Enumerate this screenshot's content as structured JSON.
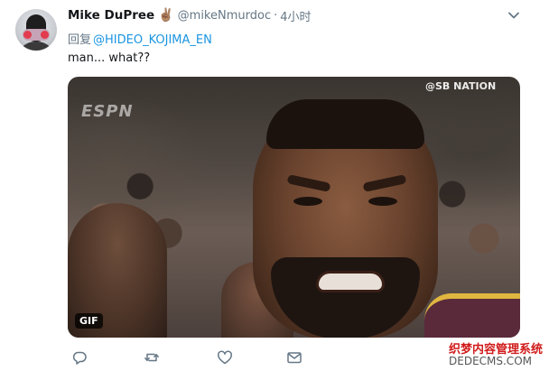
{
  "tweet": {
    "author": {
      "display_name": "Mike DuPree",
      "emoji": "✌🏽",
      "handle": "@mikeNmurdoc",
      "separator": "·",
      "time": "4小时"
    },
    "reply": {
      "prefix": "回复",
      "mention": "@HIDEO_KOJIMA_EN"
    },
    "text": "man... what??",
    "media": {
      "badge": "GIF",
      "watermark_espn": "ESPN",
      "watermark_sbn": "@SB NATION"
    },
    "actions": [
      {
        "name": "reply-icon"
      },
      {
        "name": "retweet-icon"
      },
      {
        "name": "like-icon"
      },
      {
        "name": "direct-message-icon"
      }
    ]
  },
  "site_watermark": {
    "line1": "织梦内容管理系统",
    "line2": "DEDECMS.COM"
  },
  "colors": {
    "link": "#1b95e0",
    "secondary_text": "#657786",
    "primary_text": "#14171a"
  }
}
